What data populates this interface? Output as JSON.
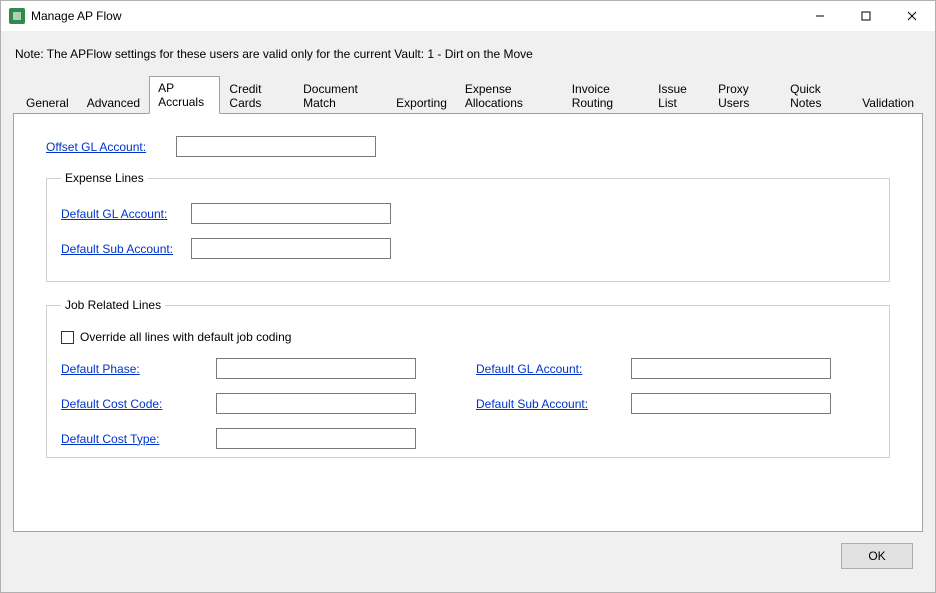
{
  "window": {
    "title": "Manage AP Flow"
  },
  "note": "Note:  The APFlow settings for these users are valid only for the current Vault: 1 - Dirt on the Move",
  "tabs": [
    {
      "label": "General"
    },
    {
      "label": "Advanced"
    },
    {
      "label": "AP Accruals"
    },
    {
      "label": "Credit Cards"
    },
    {
      "label": "Document Match"
    },
    {
      "label": "Exporting"
    },
    {
      "label": "Expense Allocations"
    },
    {
      "label": "Invoice Routing"
    },
    {
      "label": "Issue List"
    },
    {
      "label": "Proxy Users"
    },
    {
      "label": "Quick Notes"
    },
    {
      "label": "Validation"
    }
  ],
  "active_tab_index": 2,
  "form": {
    "offset_gl_label": "Offset GL Account:",
    "offset_gl_value": "",
    "expense_legend": "Expense Lines",
    "expense_default_gl_label": "Default GL Account:",
    "expense_default_gl_value": "",
    "expense_default_sub_label": "Default Sub Account:",
    "expense_default_sub_value": "",
    "job_legend": "Job Related Lines",
    "job_override_label": "Override all lines with default job coding",
    "job_override_checked": false,
    "job_default_phase_label": "Default Phase:",
    "job_default_phase_value": "",
    "job_default_costcode_label": "Default Cost Code:",
    "job_default_costcode_value": "",
    "job_default_costtype_label": "Default Cost Type:",
    "job_default_costtype_value": "",
    "job_default_gl_label": "Default GL Account:",
    "job_default_gl_value": "",
    "job_default_sub_label": "Default Sub Account:",
    "job_default_sub_value": ""
  },
  "buttons": {
    "ok": "OK"
  }
}
